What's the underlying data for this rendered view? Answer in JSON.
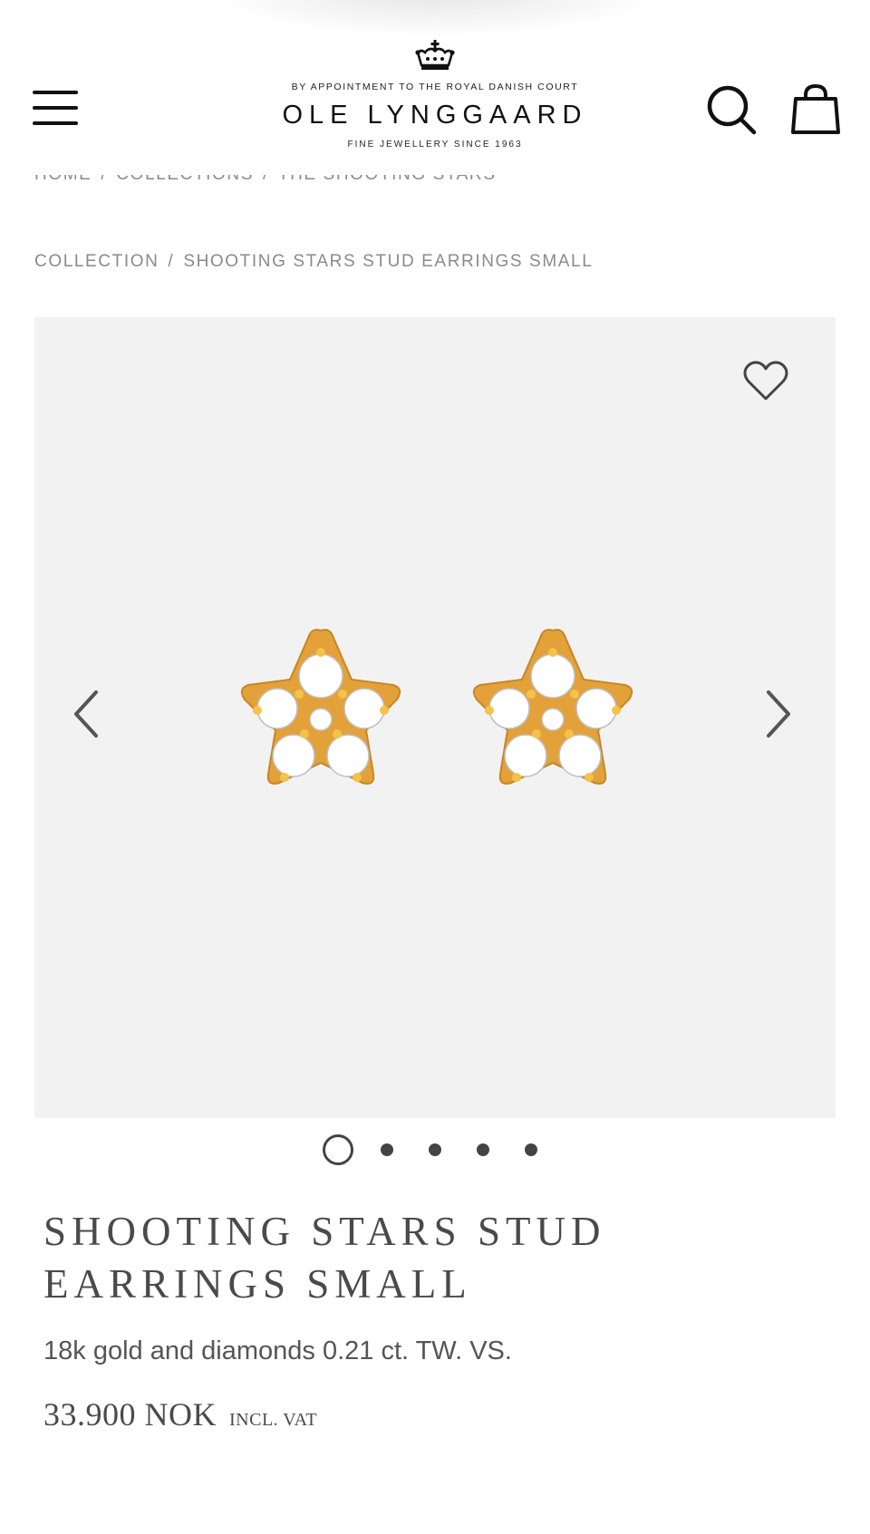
{
  "header": {
    "appointment": "BY APPOINTMENT TO THE ROYAL DANISH COURT",
    "brand": "OLE LYNGGAARD",
    "since": "FINE JEWELLERY SINCE 1963",
    "icons": {
      "menu": "hamburger-menu-icon",
      "crown": "crown-icon",
      "search": "search-icon",
      "bag": "shopping-bag-icon"
    }
  },
  "breadcrumb": {
    "items": [
      "HOME",
      "COLLECTIONS",
      "THE SHOOTING STARS",
      "COLLECTION",
      "SHOOTING STARS STUD EARRINGS SMALL"
    ],
    "separator": "/"
  },
  "gallery": {
    "slide_count": 5,
    "active_slide": 1,
    "icons": {
      "wishlist": "heart-icon",
      "prev": "chevron-left-icon",
      "next": "chevron-right-icon"
    }
  },
  "product": {
    "title": "SHOOTING STARS STUD EARRINGS SMALL",
    "description": "18k gold and diamonds 0.21 ct. TW. VS.",
    "price": "33.900 NOK",
    "vat": "INCL. VAT"
  },
  "colors": {
    "background": "#ffffff",
    "gallery_bg": "#f2f2f2",
    "text": "#4a4a4a",
    "breadcrumb": "#8a8a8a",
    "gold": "#e8a524"
  }
}
